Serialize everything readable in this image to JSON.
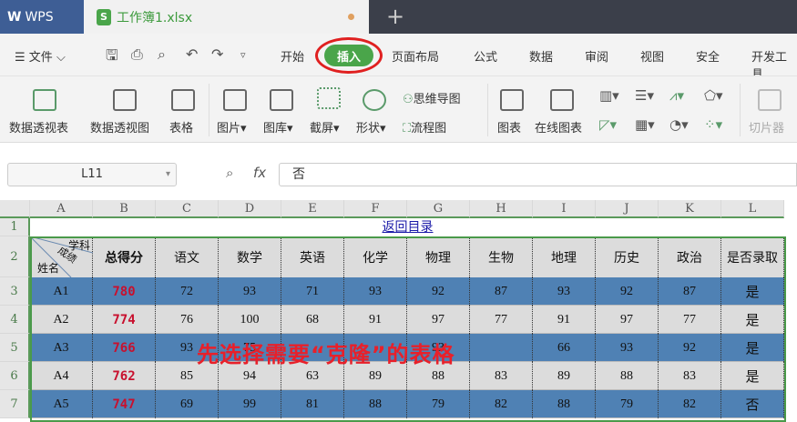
{
  "titlebar": {
    "app": "WPS",
    "file_tab": "工作簿1.xlsx",
    "file_icon": "S",
    "new_tab": "+"
  },
  "menubar": {
    "file": "文件",
    "items": [
      "开始",
      "插入",
      "页面布局",
      "公式",
      "数据",
      "审阅",
      "视图",
      "安全",
      "开发工具"
    ],
    "active": "插入"
  },
  "toolbar": {
    "pivot_table": "数据透视表",
    "pivot_chart": "数据透视图",
    "table": "表格",
    "picture": "图片",
    "gallery": "图库",
    "screenshot": "截屏",
    "shape": "形状",
    "mindmap": "思维导图",
    "flowchart": "流程图",
    "chart": "图表",
    "online_chart": "在线图表",
    "slicer": "切片器"
  },
  "formula_bar": {
    "cell_ref": "L11",
    "fx": "fx",
    "value": "否"
  },
  "sheet": {
    "columns": [
      "A",
      "B",
      "C",
      "D",
      "E",
      "F",
      "G",
      "H",
      "I",
      "J",
      "K",
      "L"
    ],
    "row_numbers": [
      "1",
      "2",
      "3",
      "4",
      "5",
      "6",
      "7"
    ],
    "link": "返回目录",
    "corner": {
      "top": "学科",
      "middle": "成绩",
      "bottom": "姓名"
    },
    "headers": [
      "总得分",
      "语文",
      "数学",
      "英语",
      "化学",
      "物理",
      "生物",
      "地理",
      "历史",
      "政治",
      "是否录取"
    ],
    "rows": [
      [
        "A1",
        "780",
        "72",
        "93",
        "71",
        "93",
        "92",
        "87",
        "93",
        "92",
        "87",
        "是"
      ],
      [
        "A2",
        "774",
        "76",
        "100",
        "68",
        "91",
        "97",
        "77",
        "91",
        "97",
        "77",
        "是"
      ],
      [
        "A3",
        "766",
        "93",
        "75",
        "",
        "",
        "93",
        "",
        "66",
        "93",
        "92",
        "是"
      ],
      [
        "A4",
        "762",
        "85",
        "94",
        "63",
        "89",
        "88",
        "83",
        "89",
        "88",
        "83",
        "是"
      ],
      [
        "A5",
        "747",
        "69",
        "99",
        "81",
        "88",
        "79",
        "82",
        "88",
        "79",
        "82",
        "否"
      ]
    ]
  },
  "annotation": "先选择需要“克隆”的表格",
  "colors": {
    "accent": "#4aa54a",
    "row_blue": "#4f81b4",
    "row_grey": "#dcdcdc",
    "total": "#c8102e",
    "annotation": "#e8202a"
  }
}
